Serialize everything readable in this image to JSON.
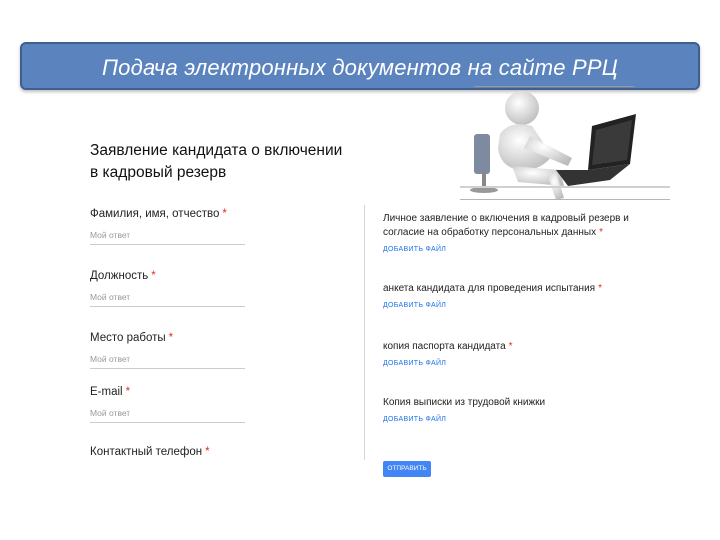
{
  "slide": {
    "title": "Подача электронных документов на сайте РРЦ",
    "caption_line1": "Заявление  кандидата о включении",
    "caption_line2": "в кадровый резерв"
  },
  "form_left": {
    "fields": [
      {
        "label": "Фамилия, имя, отчество",
        "placeholder": "Мой ответ"
      },
      {
        "label": "Должность",
        "placeholder": "Мой ответ"
      },
      {
        "label": "Место работы",
        "placeholder": "Мой ответ"
      },
      {
        "label": "E-mail",
        "placeholder": "Мой ответ"
      },
      {
        "label": "Контактный телефон",
        "placeholder": ""
      }
    ],
    "required_mark": "*"
  },
  "form_right": {
    "fields": [
      {
        "label_line1": "Личное заявление о включения в кадровый резерв и",
        "label_line2": "согласие на обработку персональных данных",
        "required": true
      },
      {
        "label_line1": "анкета кандидата для проведения испытания",
        "label_line2": "",
        "required": true
      },
      {
        "label_line1": "копия паспорта кандидата",
        "label_line2": "",
        "required": true
      },
      {
        "label_line1": "Копия выписки из трудовой книжки",
        "label_line2": "",
        "required": false
      }
    ],
    "add_file_label": "ДОБАВИТЬ ФАЙЛ",
    "submit_label": "ОТПРАВИТЬ"
  },
  "colors": {
    "title_bar": "#5b84be",
    "required": "#d93025",
    "link": "#1a73e8",
    "submit": "#4285f4"
  },
  "illustration": "person-at-laptop-icon"
}
